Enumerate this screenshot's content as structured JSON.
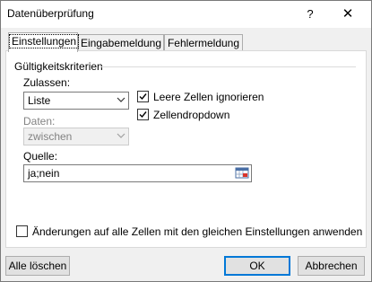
{
  "window": {
    "title": "Datenüberprüfung",
    "help": "?",
    "close": "✕"
  },
  "tabs": [
    {
      "label": "Einstellungen",
      "active": true
    },
    {
      "label": "Eingabemeldung",
      "active": false
    },
    {
      "label": "Fehlermeldung",
      "active": false
    }
  ],
  "criteria": {
    "group_label": "Gültigkeitskriterien",
    "allow_label": "Zulassen:",
    "allow_value": "Liste",
    "ignore_blank_label": "Leere Zellen ignorieren",
    "ignore_blank_checked": true,
    "dropdown_label": "Zellendropdown",
    "dropdown_checked": true,
    "data_label": "Daten:",
    "data_value": "zwischen",
    "source_label": "Quelle:",
    "source_value": "ja;nein"
  },
  "apply_all_label": "Änderungen auf alle Zellen mit den gleichen Einstellungen anwenden",
  "apply_all_checked": false,
  "buttons": {
    "clear_all": "Alle löschen",
    "ok": "OK",
    "cancel": "Abbrechen"
  },
  "icons": {
    "combo_arrow": "chevron-down-icon",
    "range_picker": "range-select-icon",
    "check": "✓"
  }
}
